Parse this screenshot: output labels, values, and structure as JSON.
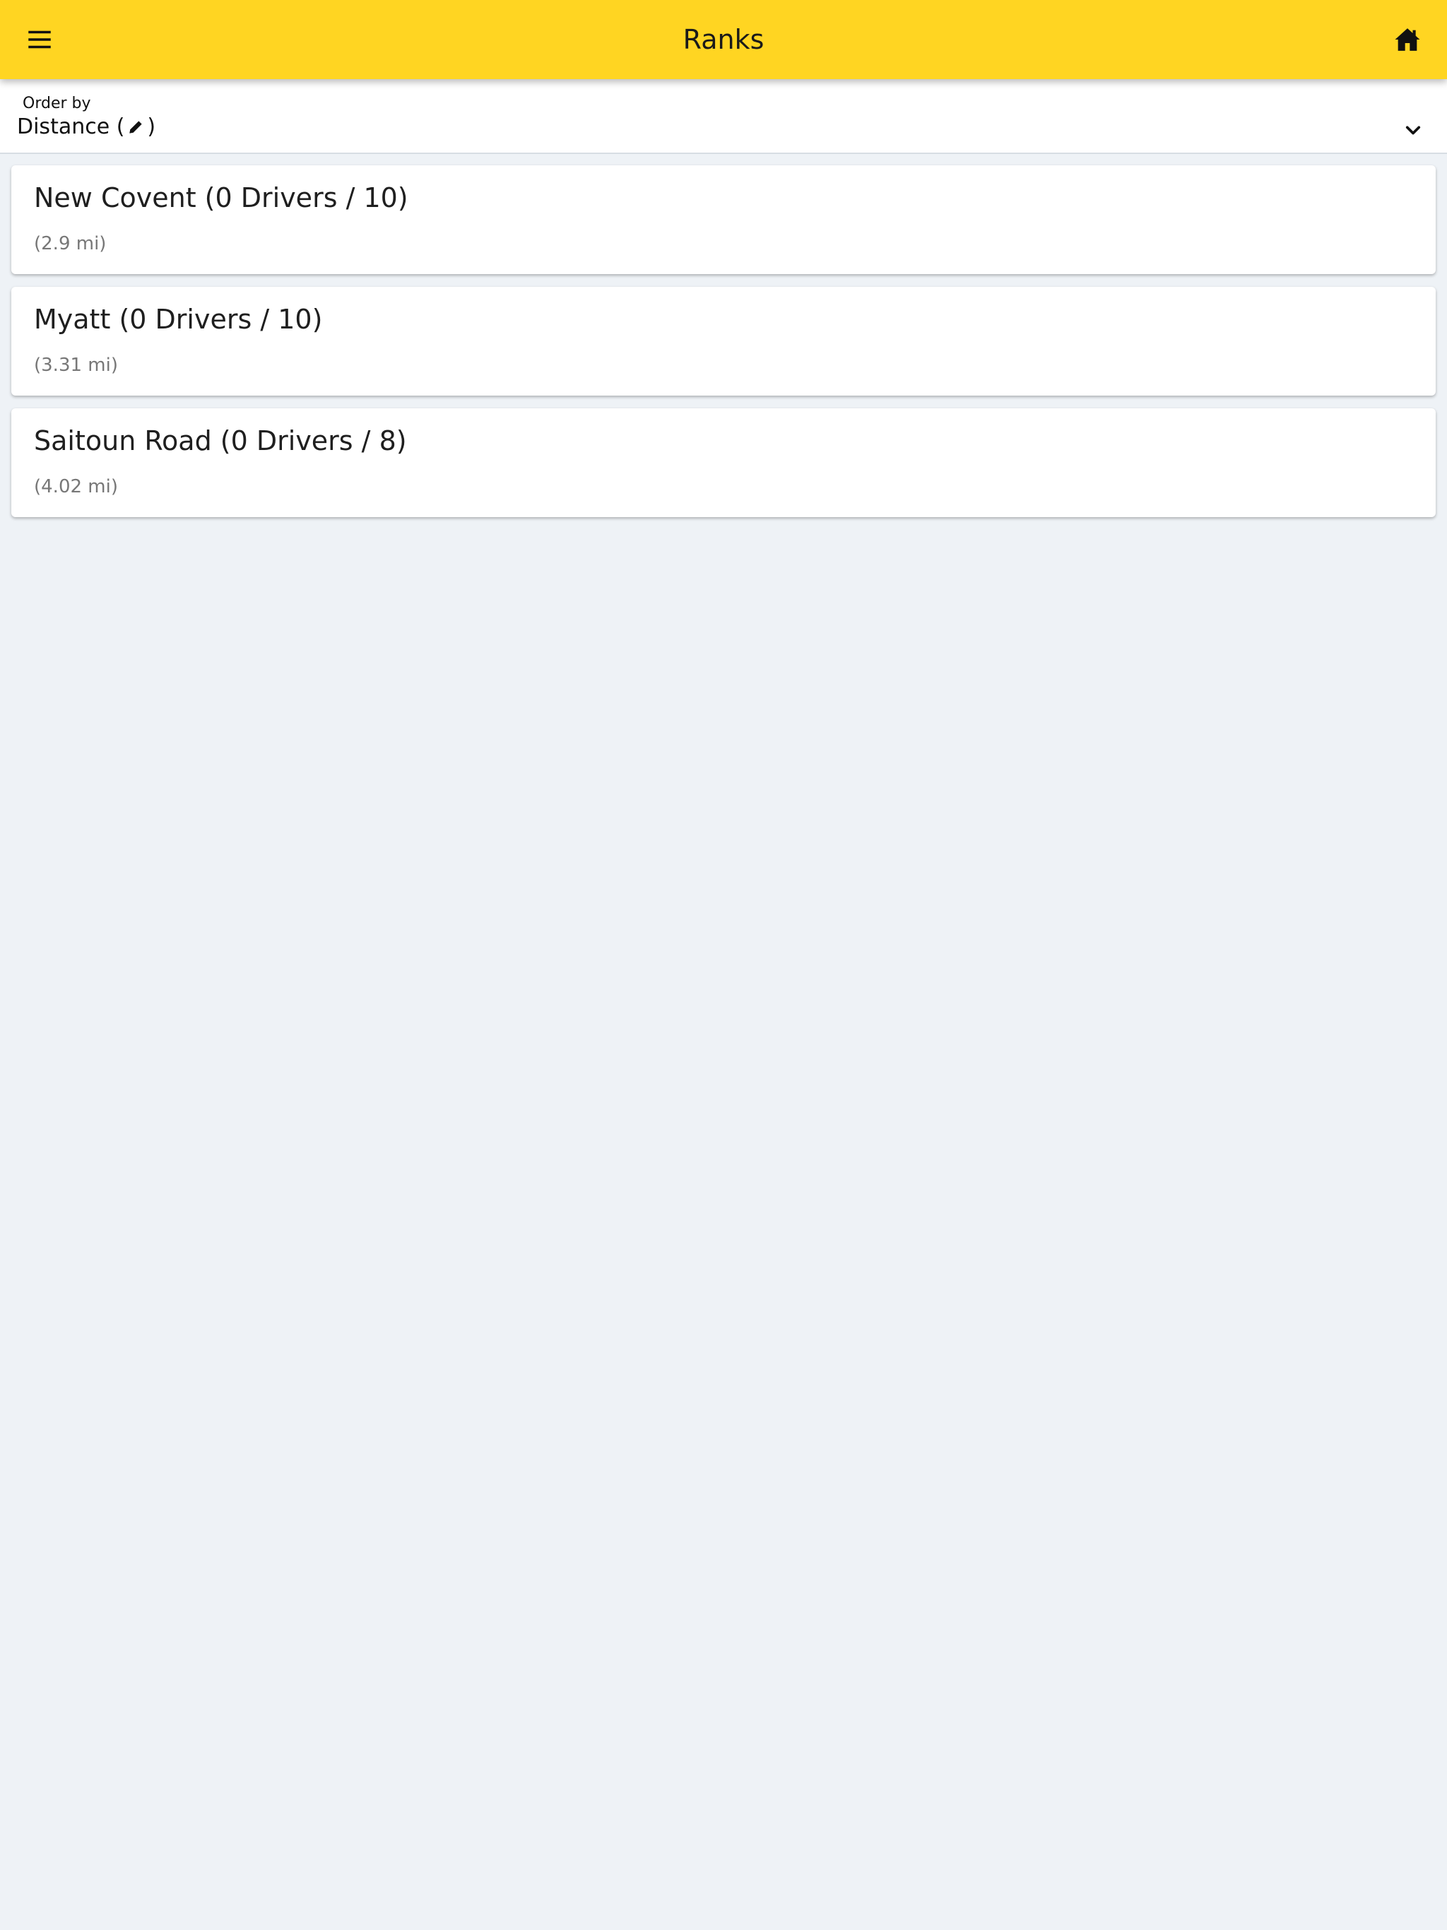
{
  "header": {
    "title": "Ranks",
    "menu_icon": "menu-icon",
    "home_icon": "home-icon",
    "accent_color": "#ffd522"
  },
  "order_by": {
    "label": "Order by",
    "value_prefix": "Distance (",
    "value_suffix": ")",
    "value_icon": "pencil-icon",
    "dropdown_icon": "chevron-down-icon"
  },
  "ranks": [
    {
      "title": "New Covent (0 Drivers / 10)",
      "distance": "(2.9 mi)"
    },
    {
      "title": "Myatt (0 Drivers / 10)",
      "distance": "(3.31 mi)"
    },
    {
      "title": "Saitoun Road (0 Drivers / 8)",
      "distance": "(4.02 mi)"
    }
  ]
}
